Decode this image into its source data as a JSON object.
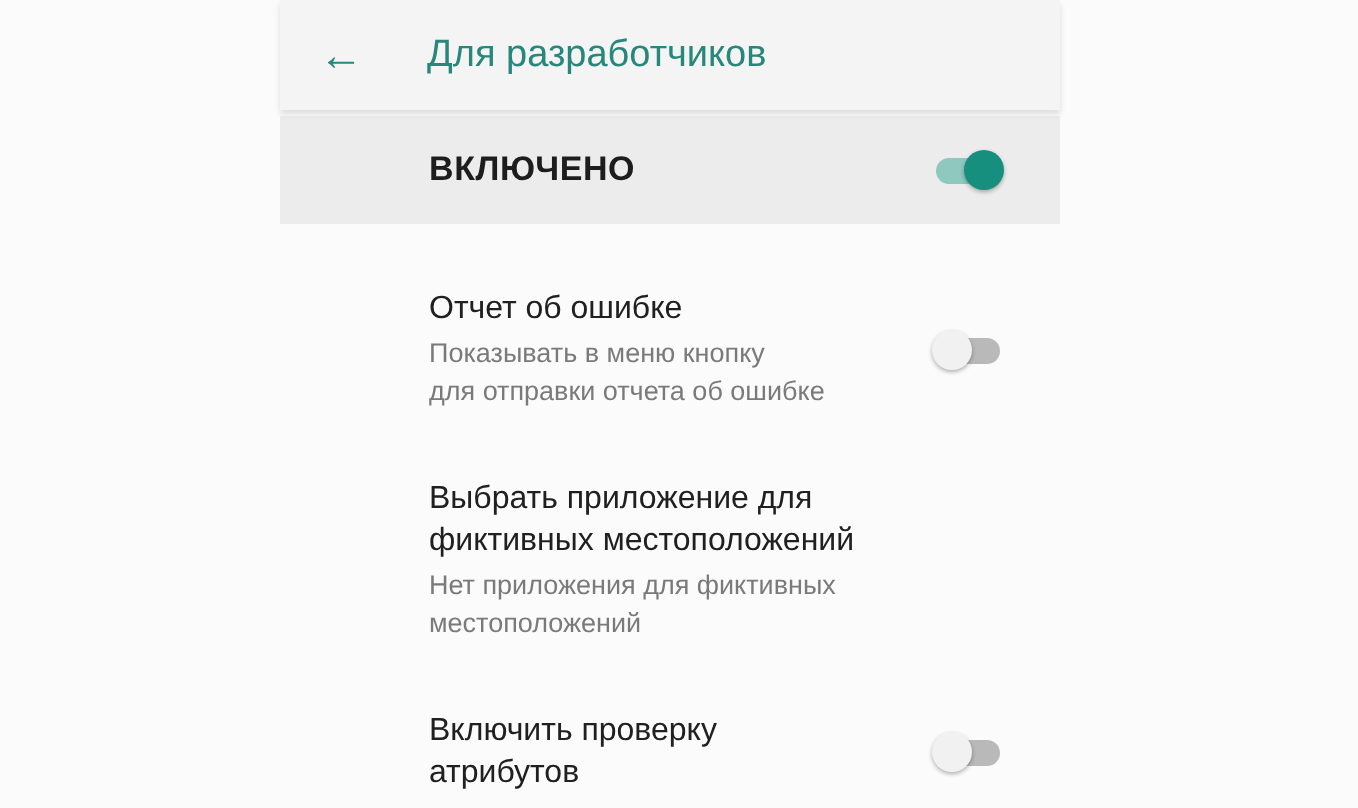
{
  "app_bar": {
    "back": "←",
    "title": "Для разработчиков"
  },
  "master_switch": {
    "label": "ВКЛЮЧЕНО",
    "on": true
  },
  "settings": [
    {
      "kind": "switch",
      "title_lines": [
        "Отчет об ошибке"
      ],
      "summary_lines": [
        "Показывать в меню кнопку",
        "для отправки отчета об ошибке"
      ],
      "on": false
    },
    {
      "kind": "plain",
      "title_lines": [
        "Выбрать приложение для",
        "фиктивных местоположений"
      ],
      "summary_lines": [
        "Нет приложения для фиктивных",
        "местоположений"
      ]
    },
    {
      "kind": "switch",
      "title_lines": [
        "Включить проверку",
        "атрибутов"
      ],
      "on": false
    }
  ]
}
